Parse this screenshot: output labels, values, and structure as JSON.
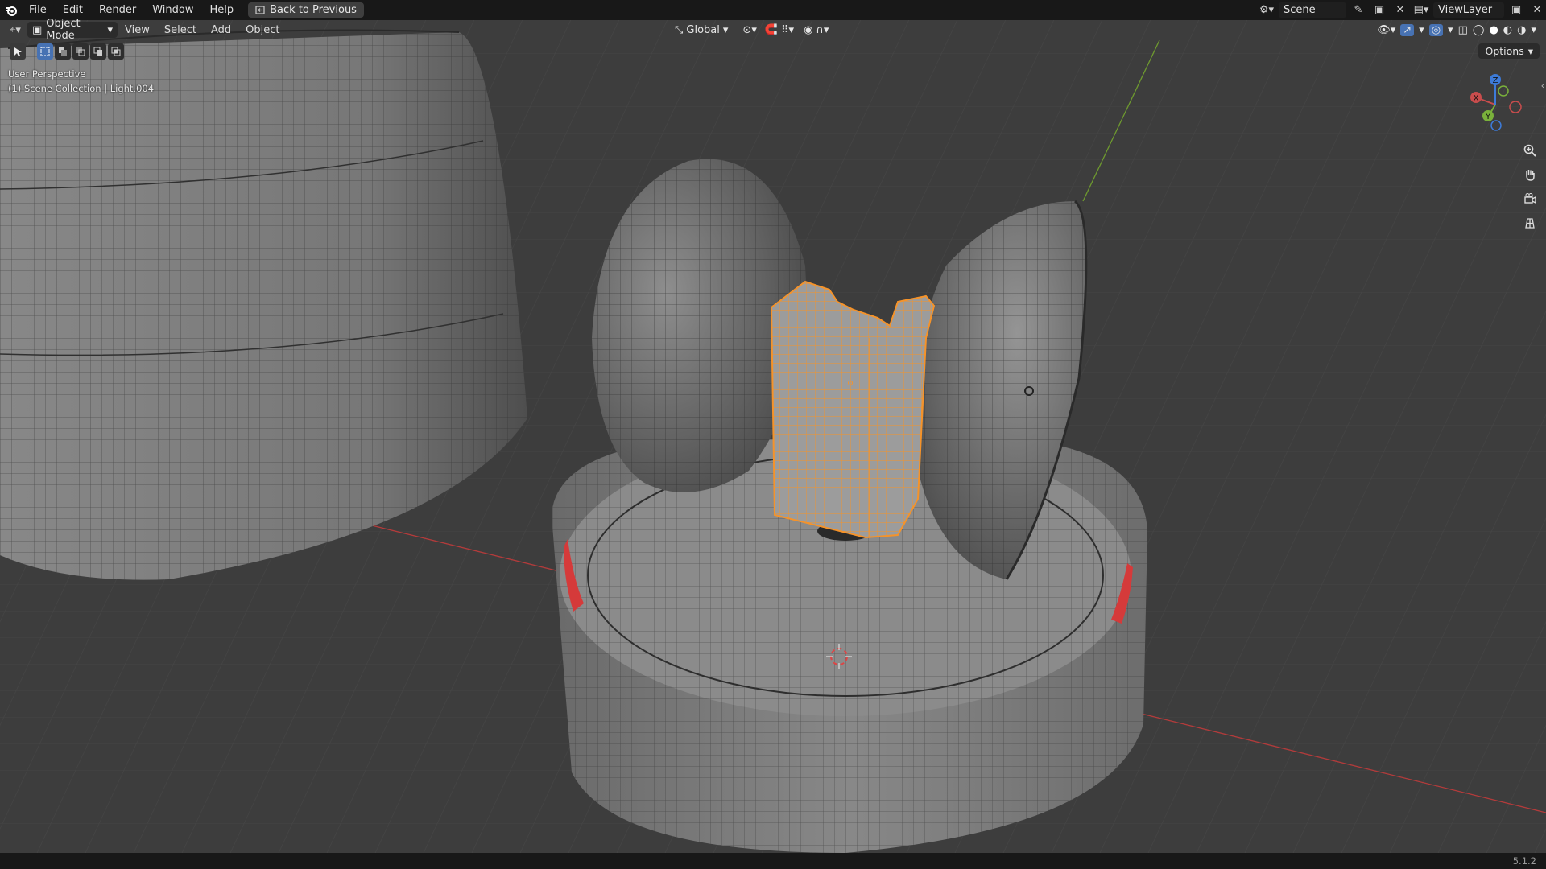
{
  "topbar": {
    "menus": [
      "File",
      "Edit",
      "Render",
      "Window",
      "Help"
    ],
    "back_button": "Back to Previous",
    "scene_name": "Scene",
    "view_layer": "ViewLayer"
  },
  "header": {
    "mode": "Object Mode",
    "menus": [
      "View",
      "Select",
      "Add",
      "Object"
    ],
    "transform_orientation": "Global",
    "options_label": "Options"
  },
  "viewport": {
    "perspective_label": "User Perspective",
    "collection_label": "(1) Scene Collection | Light.004",
    "gizmo_axes": [
      "X",
      "Y",
      "Z"
    ],
    "selection_color": "#f5932a",
    "background_color": "#3d3d3d"
  },
  "statusbar": {
    "version": "5.1.2"
  }
}
